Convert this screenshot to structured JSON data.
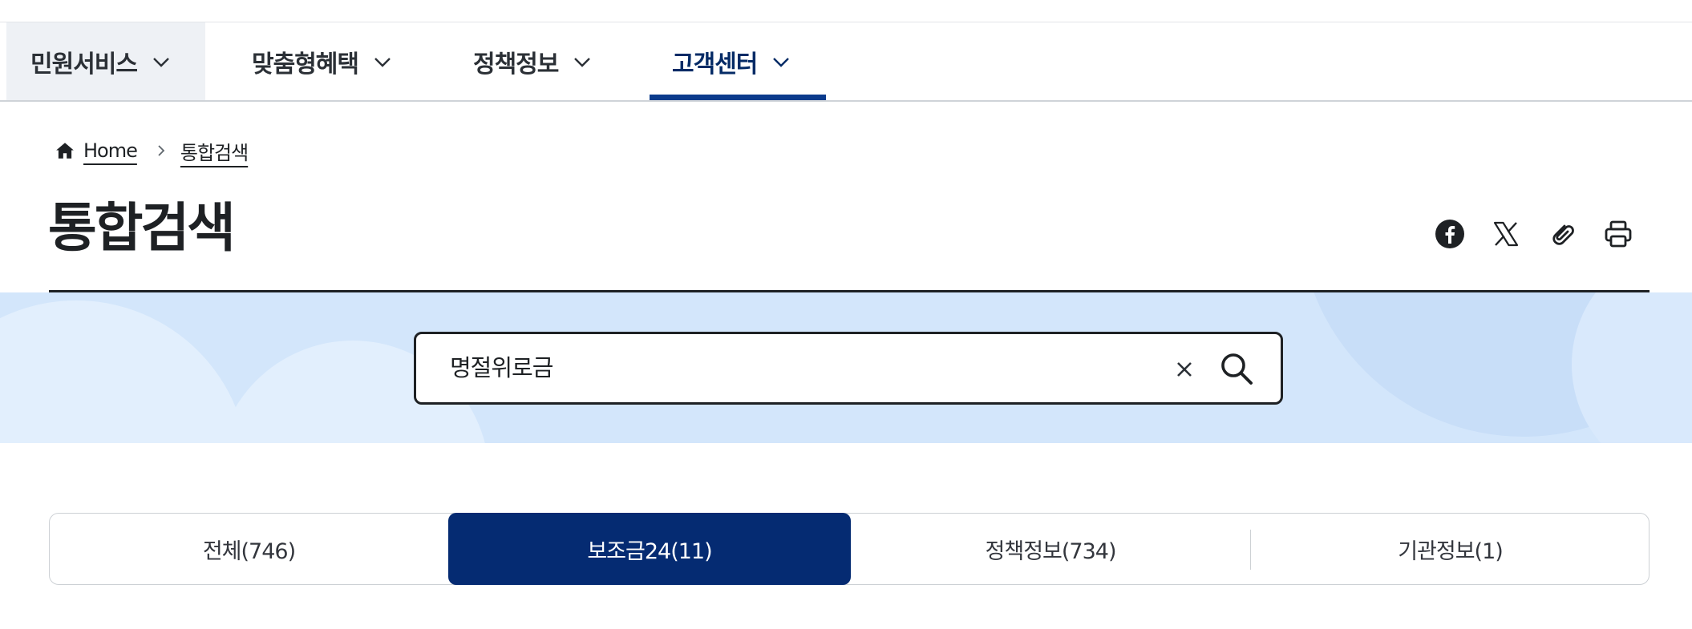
{
  "nav": {
    "items": [
      {
        "label": "민원서비스"
      },
      {
        "label": "맞춤형혜택"
      },
      {
        "label": "정책정보"
      },
      {
        "label": "고객센터"
      }
    ]
  },
  "breadcrumb": {
    "home": "Home",
    "current": "통합검색"
  },
  "page": {
    "title": "통합검색"
  },
  "share": [
    "facebook-icon",
    "x-icon",
    "link-icon",
    "print-icon"
  ],
  "search": {
    "value": "명절위로금"
  },
  "tabs": [
    {
      "label": "전체(746)"
    },
    {
      "label": "보조금24(11)"
    },
    {
      "label": "정책정보(734)"
    },
    {
      "label": "기관정보(1)"
    }
  ],
  "colors": {
    "accent": "#052b72",
    "nav_active": "#0b3b8c",
    "search_band": "#d3e6fb"
  }
}
